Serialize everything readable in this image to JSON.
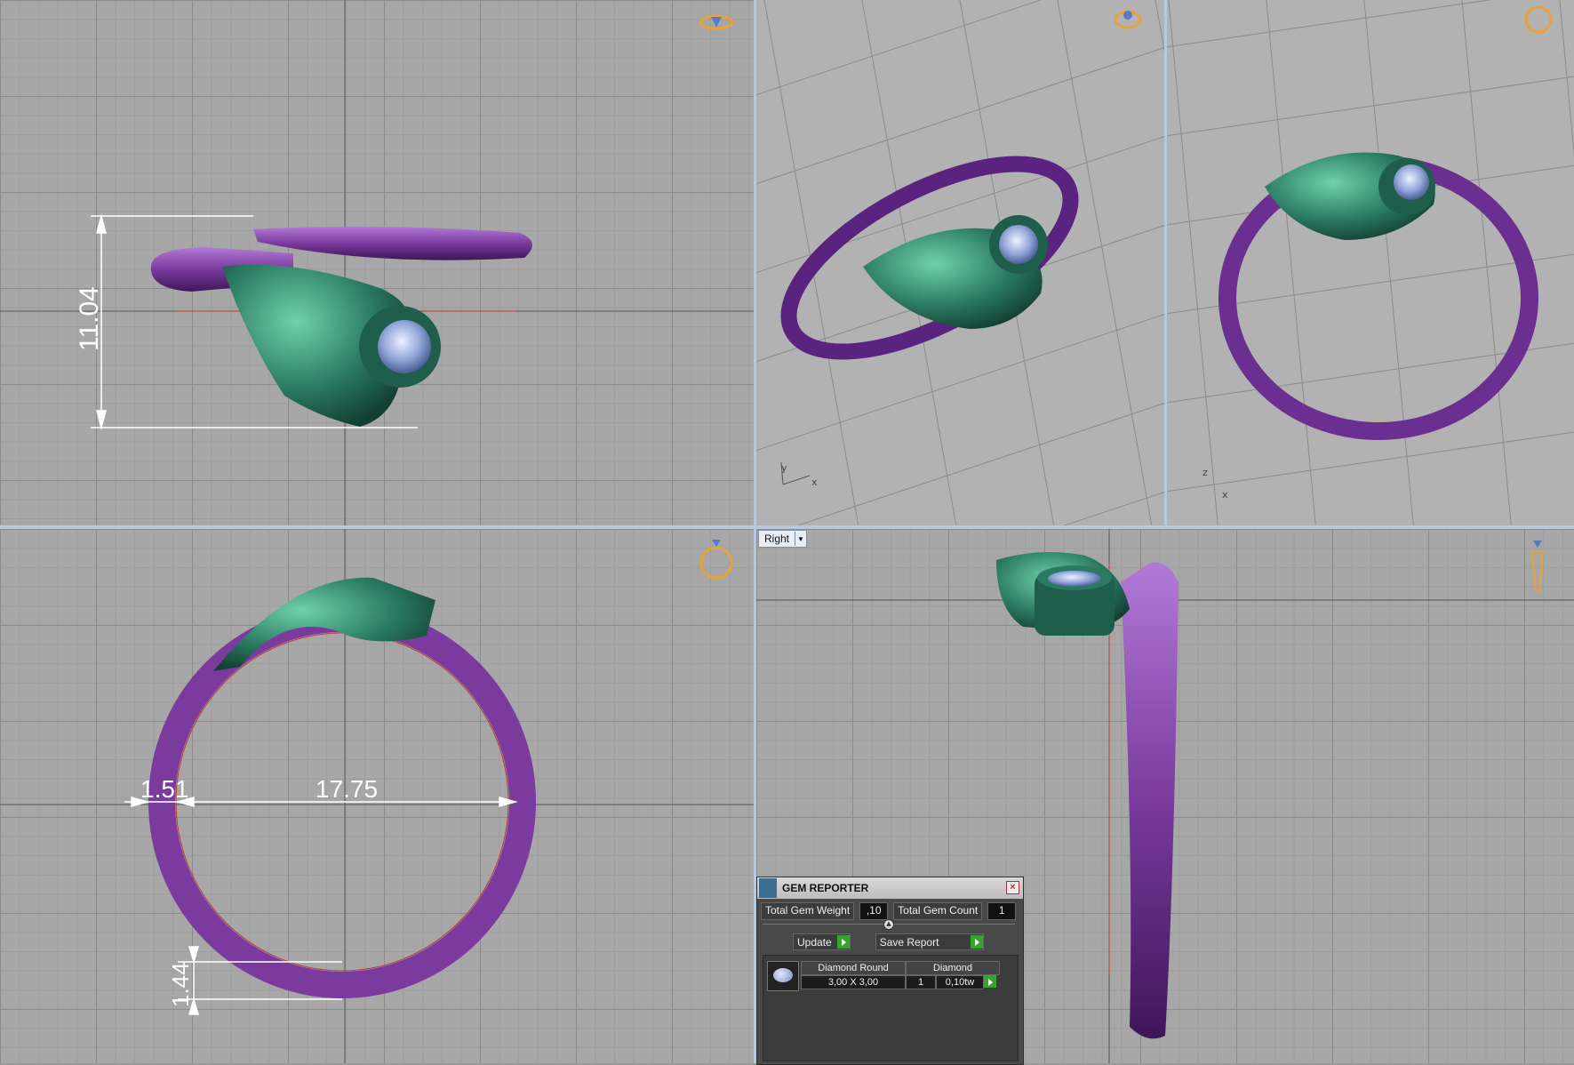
{
  "viewports": {
    "top_left": {
      "dimension_height": "11.04"
    },
    "bottom_left": {
      "dimension_inner": "17.75",
      "dimension_band": "1.51",
      "dimension_thickness": "1.44"
    },
    "bottom_right": {
      "view_label": "Right"
    }
  },
  "gem_reporter": {
    "title": "GEM REPORTER",
    "total_weight_label": "Total Gem Weight",
    "total_weight_value": ",10",
    "total_count_label": "Total Gem Count",
    "total_count_value": "1",
    "update_label": "Update",
    "save_report_label": "Save Report",
    "gems": [
      {
        "shape": "Diamond Round",
        "size": "3,00 X 3,00",
        "material": "Diamond",
        "count": "1",
        "weight": "0,10tw"
      }
    ]
  },
  "colors": {
    "band": "#7a3a9e",
    "hand": "#2a7a62",
    "gem": "#8fa3d8",
    "dimension_line": "#ffffff",
    "accent_icon": "#e8a23a"
  }
}
